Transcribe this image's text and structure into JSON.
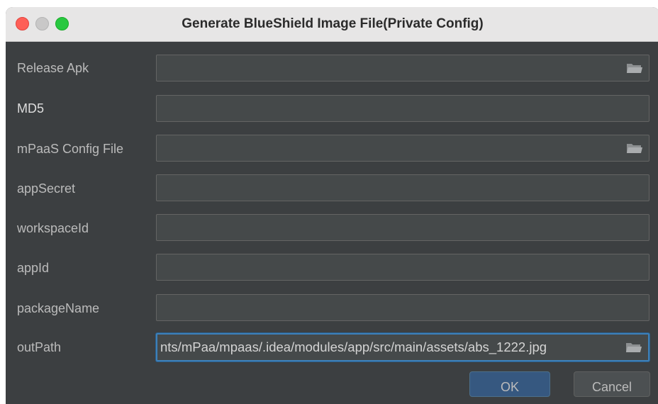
{
  "window": {
    "title": "Generate BlueShield Image File(Private Config)"
  },
  "form": {
    "fields": [
      {
        "label": "Release Apk",
        "value": "",
        "has_browse": true
      },
      {
        "label": "MD5",
        "value": "",
        "has_browse": false
      },
      {
        "label": "mPaaS Config File",
        "value": "",
        "has_browse": true
      },
      {
        "label": "appSecret",
        "value": "",
        "has_browse": false
      },
      {
        "label": "workspaceId",
        "value": "",
        "has_browse": false
      },
      {
        "label": "appId",
        "value": "",
        "has_browse": false
      },
      {
        "label": "packageName",
        "value": "",
        "has_browse": false
      },
      {
        "label": "outPath",
        "value": "nts/mPaa/mpaas/.idea/modules/app/src/main/assets/abs_1222.jpg",
        "has_browse": true
      }
    ]
  },
  "buttons": {
    "ok_label": "OK",
    "cancel_label": "Cancel"
  },
  "icons": {
    "browse": "folder-icon",
    "close": "close-icon",
    "minimize": "minimize-icon",
    "maximize": "maximize-icon"
  },
  "colors": {
    "background": "#3c3f41",
    "field_background": "#45494a",
    "focus_border": "#3d80b9",
    "ok_button": "#365880"
  }
}
